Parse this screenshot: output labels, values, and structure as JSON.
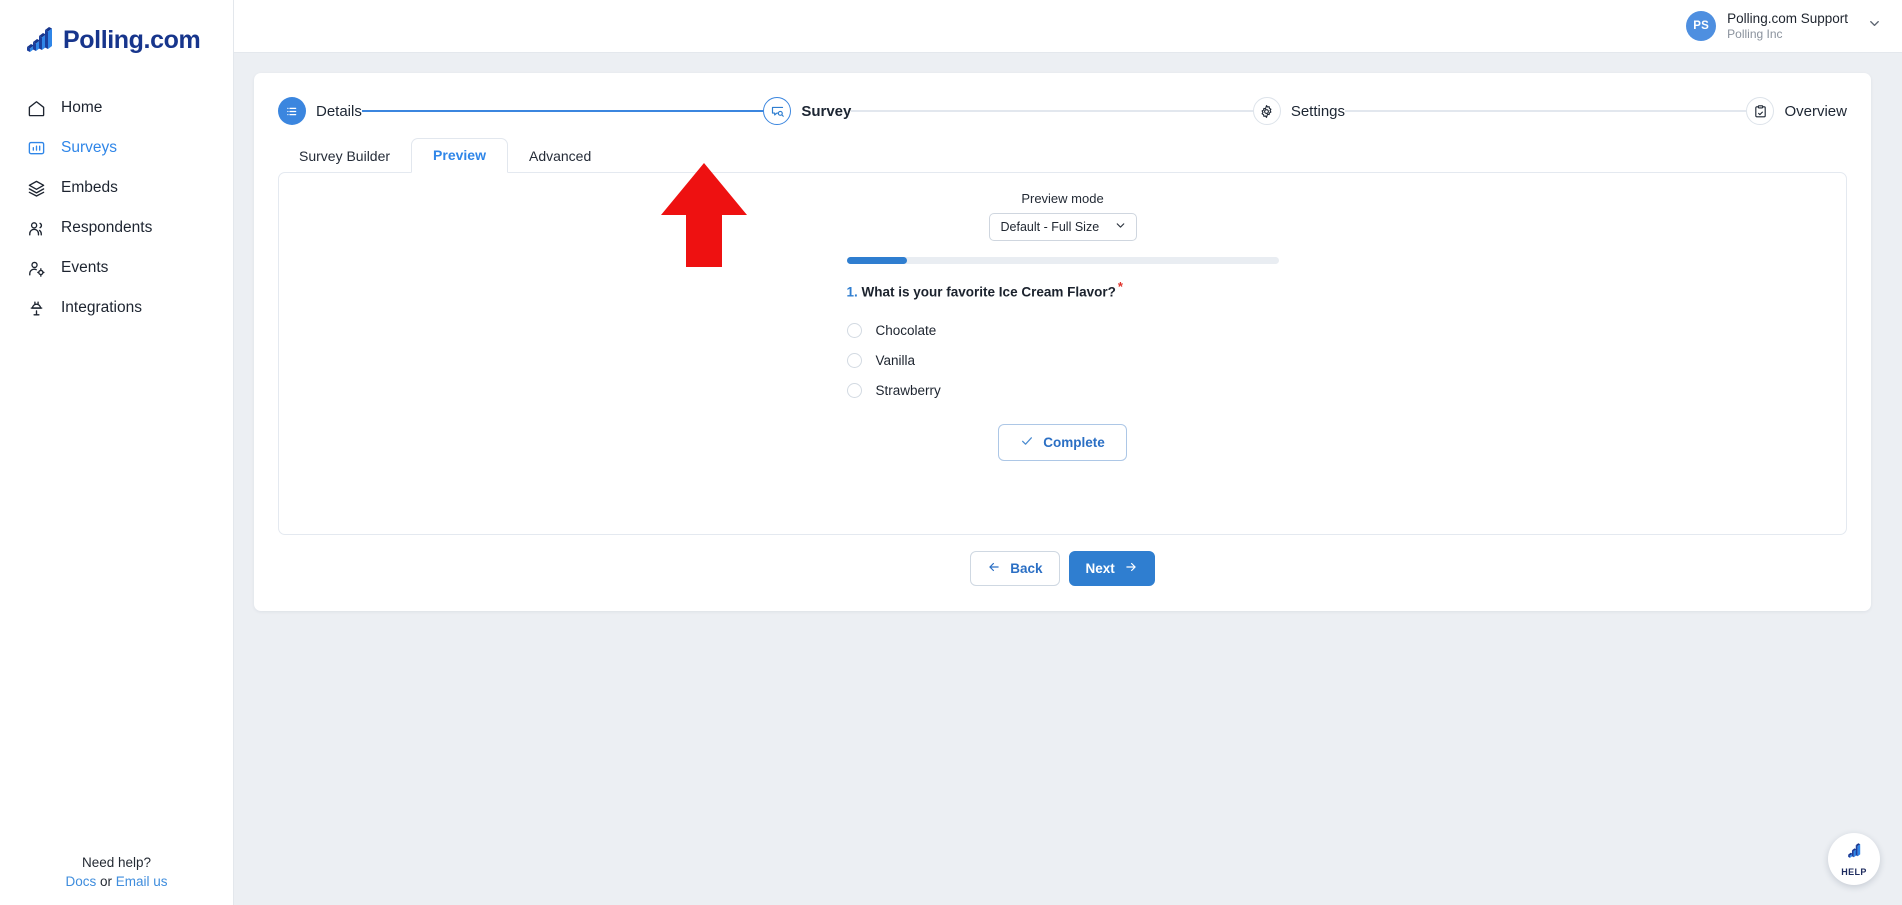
{
  "brand": {
    "name": "Polling.com",
    "logo_icon": "bar-chart-logo"
  },
  "sidebar": {
    "items": [
      {
        "label": "Home",
        "icon": "home-icon",
        "active": false
      },
      {
        "label": "Surveys",
        "icon": "survey-chart-icon",
        "active": true
      },
      {
        "label": "Embeds",
        "icon": "layers-icon",
        "active": false
      },
      {
        "label": "Respondents",
        "icon": "users-icon",
        "active": false
      },
      {
        "label": "Events",
        "icon": "user-gear-icon",
        "active": false
      },
      {
        "label": "Integrations",
        "icon": "plug-icon",
        "active": false
      }
    ],
    "help": {
      "title": "Need help?",
      "docs": "Docs",
      "separator": "or",
      "email": "Email us"
    }
  },
  "topbar": {
    "user": {
      "initials": "PS",
      "name": "Polling.com Support",
      "org": "Polling Inc"
    },
    "chevron_icon": "chevron-down-icon"
  },
  "stepper": {
    "steps": [
      {
        "label": "Details",
        "icon": "list-icon",
        "state": "done"
      },
      {
        "label": "Survey",
        "icon": "message-search-icon",
        "state": "current"
      },
      {
        "label": "Settings",
        "icon": "gear-icon",
        "state": "todo"
      },
      {
        "label": "Overview",
        "icon": "clipboard-check-icon",
        "state": "todo"
      }
    ]
  },
  "tabs": [
    {
      "label": "Survey Builder",
      "active": false
    },
    {
      "label": "Preview",
      "active": true
    },
    {
      "label": "Advanced",
      "active": false
    }
  ],
  "preview": {
    "mode_label": "Preview mode",
    "mode_value": "Default - Full Size",
    "mode_options": [
      "Default - Full Size"
    ],
    "progress_percent": 14,
    "question": {
      "number": "1.",
      "text": "What is your favorite Ice Cream Flavor?",
      "required_mark": "*",
      "options": [
        "Chocolate",
        "Vanilla",
        "Strawberry"
      ]
    },
    "complete_label": "Complete",
    "complete_icon": "check-icon"
  },
  "footer": {
    "back_label": "Back",
    "back_icon": "arrow-left-icon",
    "next_label": "Next",
    "next_icon": "arrow-right-icon"
  },
  "help_widget": {
    "label": "HELP",
    "icon": "bar-chart-logo"
  },
  "annotation": {
    "type": "arrow-up",
    "color": "#ee1111",
    "points_at": "Preview"
  },
  "colors": {
    "accent": "#2f7ed0",
    "accent_light": "#3b86df",
    "link": "#3f8ddd",
    "page_bg": "#eceff3",
    "required": "#e0322a",
    "brand_navy": "#17358c"
  }
}
